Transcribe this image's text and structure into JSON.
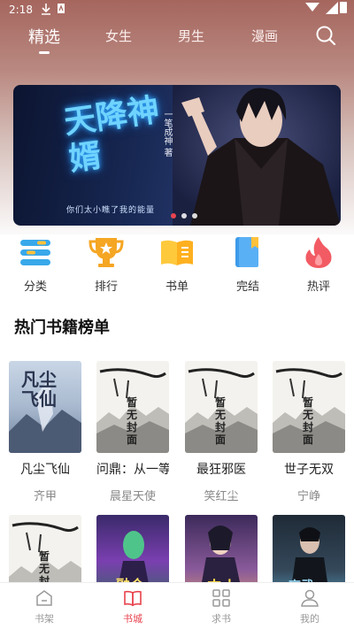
{
  "status": {
    "time": "2:18"
  },
  "top_tabs": [
    {
      "label": "精选",
      "active": true
    },
    {
      "label": "女生"
    },
    {
      "label": "男生"
    },
    {
      "label": "漫画"
    }
  ],
  "banner": {
    "title_art": "天降神婿",
    "side_text": "一笔成神 著",
    "tagline": "你们太小瞧了我的能量",
    "slide_count": 3,
    "active_slide": 1
  },
  "categories": [
    {
      "label": "分类",
      "icon": "category-icon"
    },
    {
      "label": "排行",
      "icon": "trophy-icon"
    },
    {
      "label": "书单",
      "icon": "book-list-icon"
    },
    {
      "label": "完结",
      "icon": "finished-book-icon"
    },
    {
      "label": "热评",
      "icon": "flame-icon"
    }
  ],
  "section": {
    "title": "热门书籍榜单"
  },
  "books": [
    {
      "name": "凡尘飞仙",
      "author": "齐甲",
      "cover_text": "凡尘飞仙"
    },
    {
      "name": "问鼎：从一等…",
      "author": "晨星天使",
      "cover_text": "暂无封面"
    },
    {
      "name": "最狂邪医",
      "author": "笑红尘",
      "cover_text": "暂无封面"
    },
    {
      "name": "世子无双",
      "author": "宁峥",
      "cover_text": "暂无封面"
    }
  ],
  "books_row2": [
    {
      "cover_text": "暂无封面"
    },
    {
      "cover_text": "融合"
    },
    {
      "cover_text": "史上"
    },
    {
      "cover_text": "高武"
    }
  ],
  "bottom_nav": [
    {
      "label": "书架",
      "icon": "bookshelf-icon"
    },
    {
      "label": "书城",
      "icon": "bookstore-icon",
      "active": true
    },
    {
      "label": "求书",
      "icon": "request-book-icon"
    },
    {
      "label": "我的",
      "icon": "profile-icon"
    }
  ],
  "colors": {
    "accent": "#e8424d",
    "header_top": "#a5665e"
  }
}
